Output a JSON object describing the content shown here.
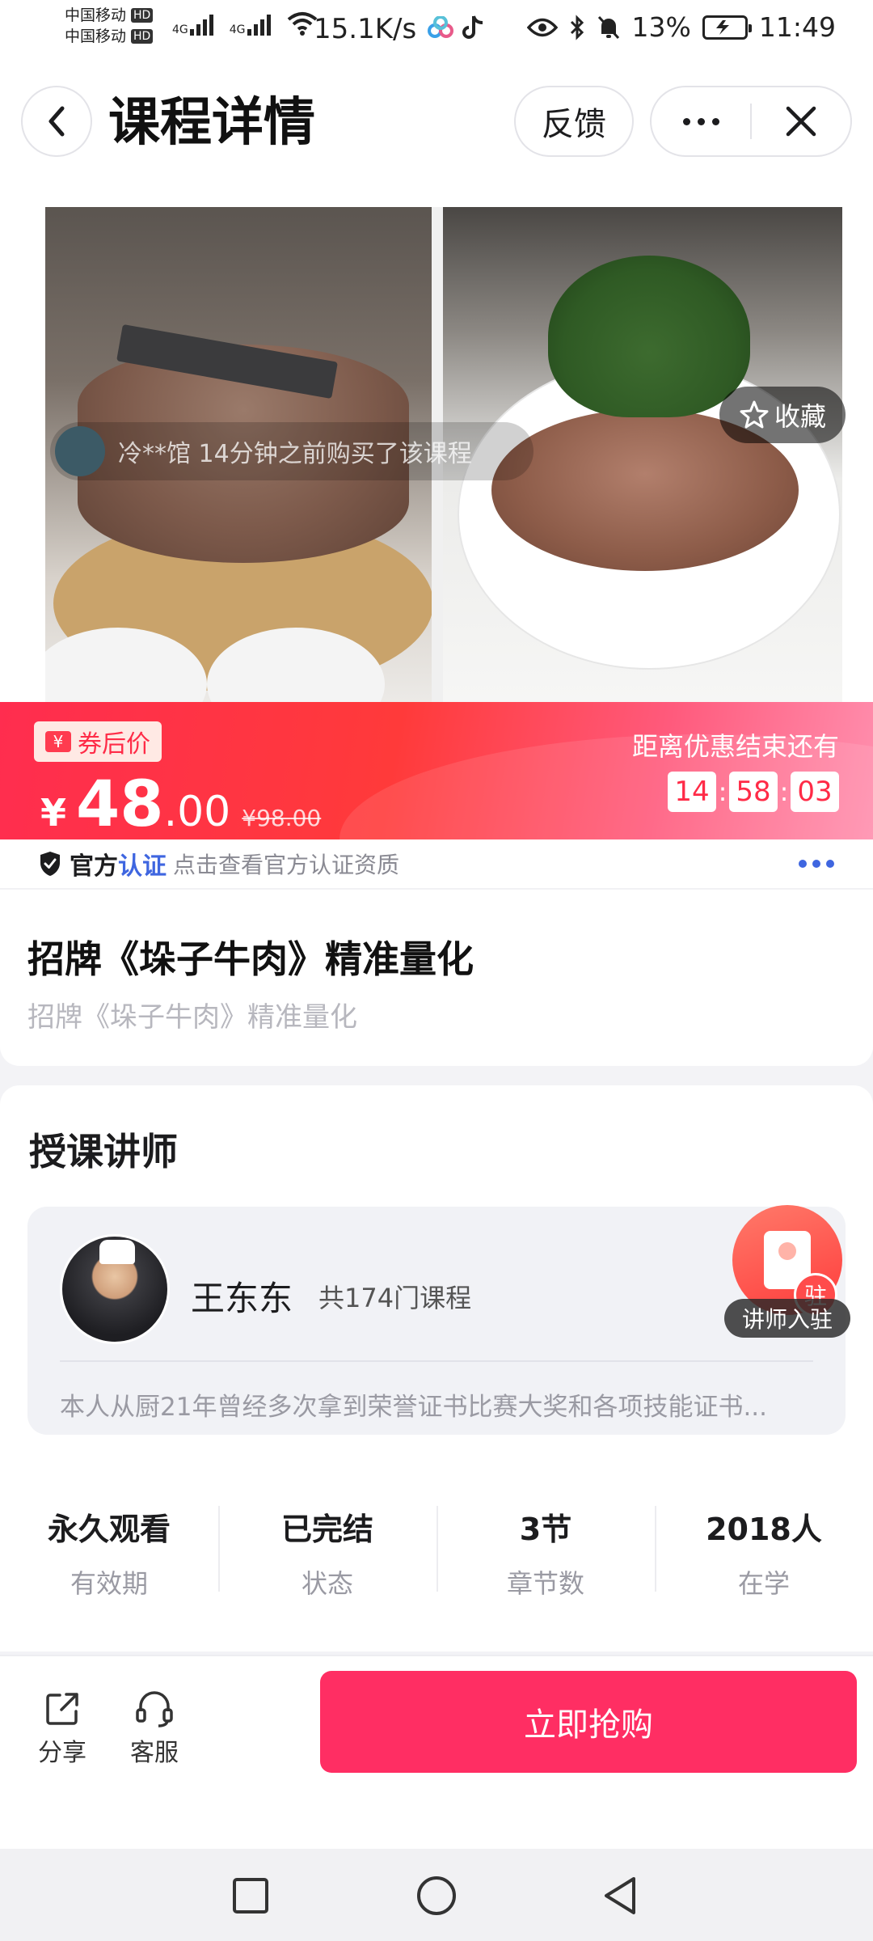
{
  "status_bar": {
    "carrier_1": "中国移动",
    "carrier_2": "中国移动",
    "hd": "HD",
    "net_1": "4G",
    "net_2": "4G",
    "speed": "15.1K/s",
    "battery": "13%",
    "time": "11:49"
  },
  "header": {
    "title": "课程详情",
    "feedback_label": "反馈"
  },
  "hero": {
    "purchase_tip": "冷**馆 14分钟之前购买了该课程",
    "favorite_label": "收藏"
  },
  "promo": {
    "coupon_label": "券后价",
    "currency": "¥",
    "price_int": "48",
    "price_dec": ".00",
    "original_price": "¥98.00",
    "countdown_label": "距离优惠结束还有",
    "countdown": {
      "h": "14",
      "m": "58",
      "s": "03"
    }
  },
  "certification": {
    "brand_part1": "官方",
    "brand_part2": "认证",
    "description": "点击查看官方认证资质"
  },
  "course": {
    "title": "招牌《垛子牛肉》精准量化",
    "subtitle": "招牌《垛子牛肉》精准量化"
  },
  "teacher": {
    "section_title": "授课讲师",
    "name": "王东东",
    "course_count": "共174门课程",
    "bio": "本人从厨21年曾经多次拿到荣誉证书比赛大奖和各项技能证书...",
    "join_badge": "讲师入驻",
    "join_badge_char": "驻"
  },
  "stats": [
    {
      "value": "永久观看",
      "label": "有效期"
    },
    {
      "value": "已完结",
      "label": "状态"
    },
    {
      "value": "3节",
      "label": "章节数"
    },
    {
      "value": "2018人",
      "label": "在学"
    }
  ],
  "actions": {
    "share_label": "分享",
    "service_label": "客服",
    "buy_label": "立即抢购"
  },
  "colors": {
    "accent": "#ff2e63",
    "promo_red": "#ff2d4f",
    "cert_blue": "#3f66e0"
  }
}
